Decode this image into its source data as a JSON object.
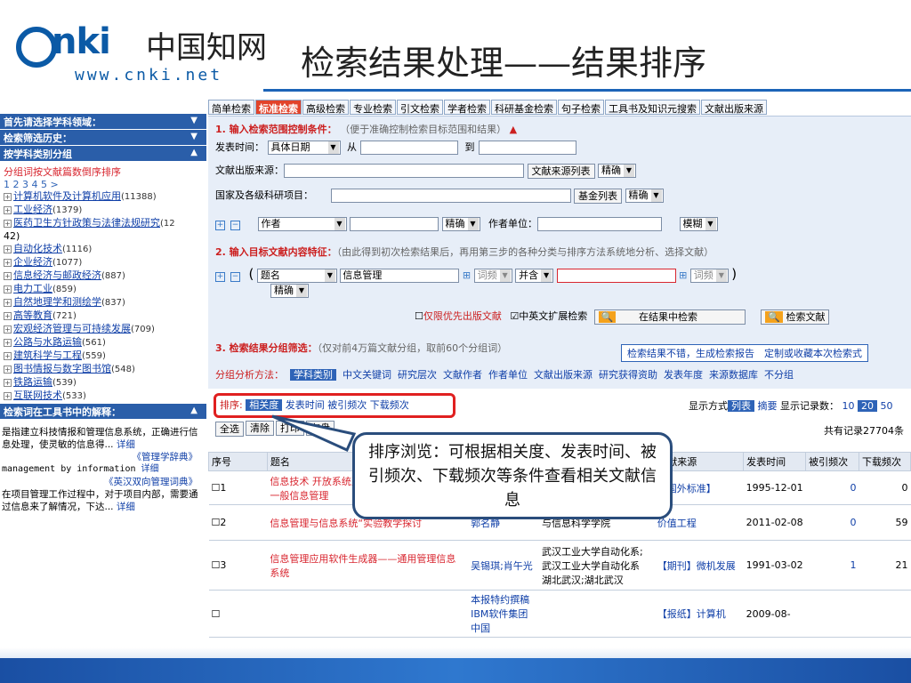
{
  "header": {
    "logo_cn": "中国知网",
    "logo_www": "www.cnki.net",
    "slide_title": "检索结果处理——结果排序"
  },
  "tabs": [
    "简单检索",
    "标准检索",
    "高级检索",
    "专业检索",
    "引文检索",
    "学者检索",
    "科研基金检索",
    "句子检索",
    "工具书及知识元搜索",
    "文献出版来源"
  ],
  "active_tab": "标准检索",
  "sidebar": {
    "headers": [
      "首先请选择学科领域：",
      "检索筛选历史：",
      "按学科类别分组",
      "检索词在工具书中的解释："
    ],
    "sort_note": "分组词按文献篇数倒序排序",
    "pages": "1 2 3 4 5 >",
    "categories": [
      {
        "label": "计算机软件及计算机应用",
        "count": "(11388)"
      },
      {
        "label": "工业经济",
        "count": "(1379)"
      },
      {
        "label": "医药卫生方针政策与法律法规研究",
        "count": "(12"
      },
      {
        "label": "自动化技术",
        "count": "(1116)"
      },
      {
        "label": "企业经济",
        "count": "(1077)"
      },
      {
        "label": "信息经济与邮政经济",
        "count": "(887)"
      },
      {
        "label": "电力工业",
        "count": "(859)"
      },
      {
        "label": "自然地理学和测绘学",
        "count": "(837)"
      },
      {
        "label": "高等教育",
        "count": "(721)"
      },
      {
        "label": "宏观经济管理与可持续发展",
        "count": "(709)"
      },
      {
        "label": "公路与水路运输",
        "count": "(561)"
      },
      {
        "label": "建筑科学与工程",
        "count": "(559)"
      },
      {
        "label": "图书情报与数字图书馆",
        "count": "(548)"
      },
      {
        "label": "铁路运输",
        "count": "(539)"
      },
      {
        "label": "互联网技术",
        "count": "(533)"
      }
    ],
    "cat_overflow": "42)",
    "explain1": "是指建立科技情报和管理信息系统，正确进行信息处理，使灵敏的信息得...",
    "detail": "详细",
    "src1": "《管理学辞典》",
    "explain2": "management by information",
    "src2": "《英汉双向管理词典》",
    "explain3": "在项目管理工作过程中，对于项目内部，需要通过信息来了解情况，下达..."
  },
  "panel": {
    "s1_title": "1. 输入检索范围控制条件：",
    "s1_note": "（便于准确控制检索目标范围和结果）",
    "pubtime_label": "发表时间：",
    "pubtime_sel": "具体日期",
    "from": "从",
    "to": "到",
    "source_label": "文献出版来源：",
    "source_btn": "文献来源列表",
    "exact": "精确",
    "fund_label": "国家及各级科研项目：",
    "fund_btn": "基金列表",
    "author_sel": "作者",
    "org_label": "作者单位：",
    "fuzzy": "模糊",
    "s2_title": "2. 输入目标文献内容特征：",
    "s2_note": "（由此得到初次检索结果后，再用第三步的各种分类与排序方法系统地分析、选择文献）",
    "field_sel": "题名",
    "term": "信息管理",
    "freq": "词频",
    "and": "并含",
    "priority": "仅限优先出版文献",
    "cross": "中英文扩展检索",
    "search_in": "在结果中检索",
    "search": "检索文献",
    "s3_title": "3. 检索结果分组筛选：",
    "s3_note": "（仅对前4万篇文献分组，取前60个分组词）",
    "report": "检索结果不错，生成检索报告　定制或收藏本次检索式",
    "group_label": "分组分析方法：",
    "groups": [
      "学科类别",
      "中文关键词",
      "研究层次",
      "文献作者",
      "作者单位",
      "文献出版来源",
      "研究获得资助",
      "发表年度",
      "来源数据库",
      "不分组"
    ]
  },
  "sort": {
    "label": "排序:",
    "options": [
      "相关度",
      "发表时间",
      "被引频次",
      "下载频次"
    ]
  },
  "display": {
    "mode_label": "显示方式",
    "list": "列表",
    "summary": "摘要",
    "count_label": "显示记录数：",
    "counts": [
      "10",
      "20",
      "50"
    ],
    "total": "共有记录27704条"
  },
  "toolbar": {
    "select_all": "全选",
    "clear": "清除",
    "print": "打印",
    "save": "存盘"
  },
  "table": {
    "headers": [
      "序号",
      "题名",
      "作者",
      "作者单位",
      "文献来源",
      "发表时间",
      "被引频次",
      "下载频次"
    ],
    "rows": [
      {
        "no": "1",
        "title": "信息技术 开放系统互连 管理信息服务定义 第一般信息管理",
        "author": "",
        "org": "",
        "source": "【国外标准】",
        "date": "1995-12-01",
        "cited": "0",
        "downloads": "0"
      },
      {
        "no": "2",
        "title": "信息管理与信息系统“实验教学探讨",
        "author": "郭名静",
        "org": "与信息科学学院",
        "source": "价值工程",
        "date": "2011-02-08",
        "cited": "0",
        "downloads": "59"
      },
      {
        "no": "3",
        "title": "信息管理应用软件生成器——通用管理信息系统",
        "author": "吴锡琪;肖午光",
        "org": "武汉工业大学自动化系;武汉工业大学自动化系 湖北武汉;湖北武汉",
        "source": "【期刊】微机发展",
        "date": "1991-03-02",
        "cited": "1",
        "downloads": "21"
      },
      {
        "no": "",
        "title": "",
        "author": "本报特约撰稿 IBM软件集团中国",
        "org": "",
        "source": "【报纸】计算机",
        "date": "2009-08-",
        "cited": "",
        "downloads": ""
      }
    ]
  },
  "callout": "排序浏览：可根据相关度、发表时间、被引频次、下载频次等条件查看相关文献信息"
}
